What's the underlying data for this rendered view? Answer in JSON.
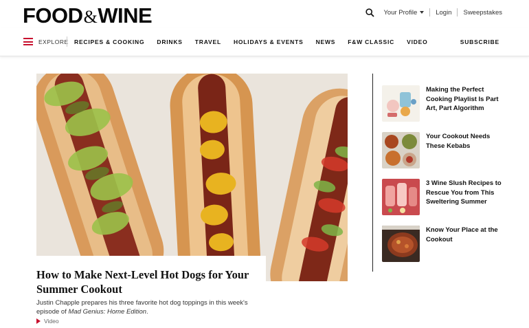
{
  "header": {
    "logo_left": "FOOD",
    "logo_amp": "&",
    "logo_right": "WINE",
    "profile": "Your Profile",
    "login": "Login",
    "sweepstakes": "Sweepstakes"
  },
  "nav": {
    "explore": "EXPLORE",
    "items": [
      "RECIPES & COOKING",
      "DRINKS",
      "TRAVEL",
      "HOLIDAYS & EVENTS",
      "NEWS",
      "F&W CLASSIC",
      "VIDEO"
    ],
    "subscribe": "SUBSCRIBE"
  },
  "hero": {
    "headline": "How to Make Next-Level Hot Dogs for Your Summer Cookout",
    "dek_prefix": "Justin Chapple prepares his three favorite hot dog toppings in this week's episode of ",
    "dek_italic": "Mad Genius: Home Edition",
    "dek_suffix": ".",
    "video_label": "Video"
  },
  "sidebar": {
    "items": [
      {
        "title": "Making the Perfect Cooking Playlist Is Part Art, Part Algorithm"
      },
      {
        "title": "Your Cookout Needs These Kebabs"
      },
      {
        "title": "3 Wine Slush Recipes to Rescue You from This Sweltering Summer"
      },
      {
        "title": "Know Your Place at the Cookout"
      }
    ]
  },
  "colors": {
    "accent": "#c8102e",
    "text": "#111111"
  }
}
